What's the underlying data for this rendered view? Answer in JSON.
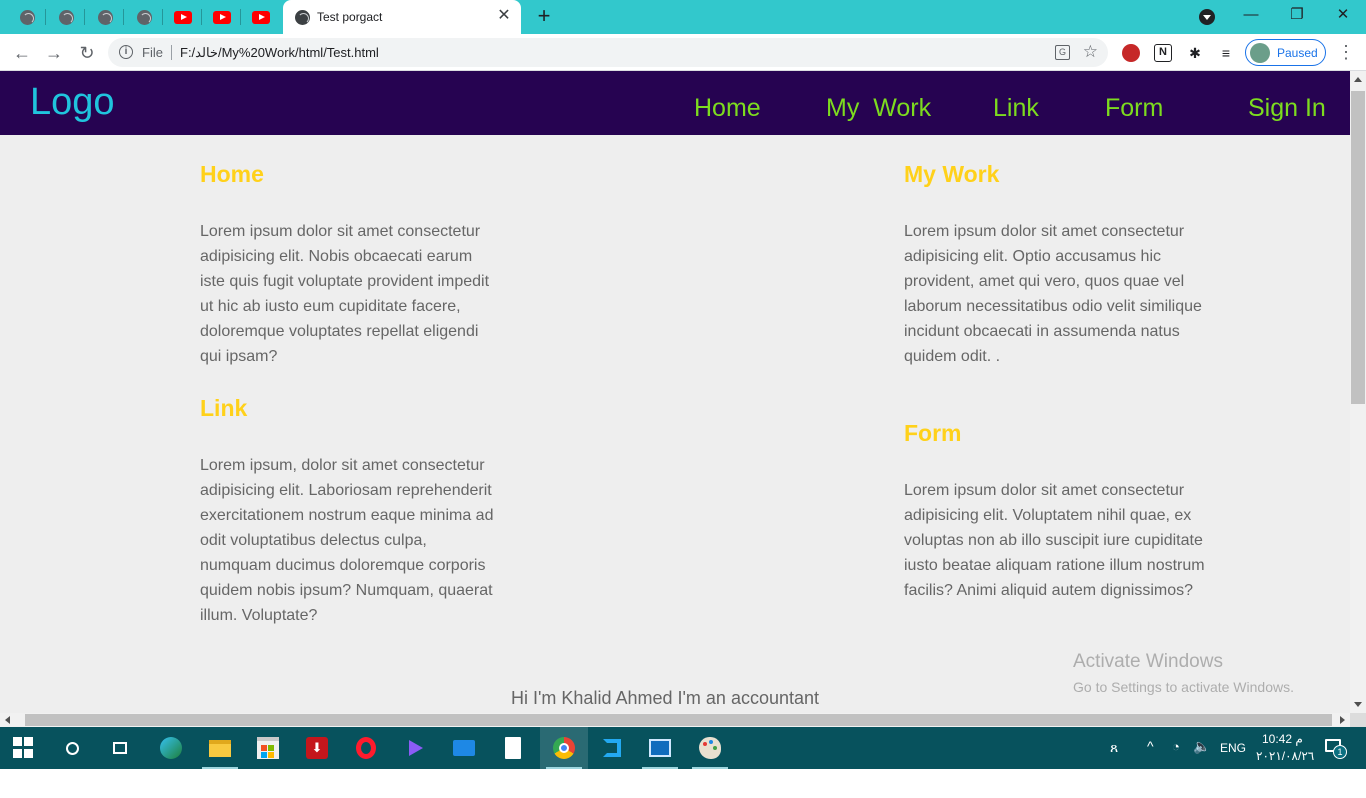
{
  "browser": {
    "active_tab_title": "Test porgact",
    "url_scheme": "File",
    "url": "F:/خالد/My%20Work/html/Test.html",
    "profile_status": "Paused",
    "tab_close": "✕",
    "new_tab": "+",
    "minimize": "—",
    "restore": "❐",
    "close": "✕"
  },
  "site": {
    "logo": "Logo",
    "nav": [
      "Home",
      "My  Work",
      "Link",
      "Form",
      "Sign In"
    ],
    "sections": [
      {
        "title": "Home",
        "body": "Lorem ipsum dolor sit amet consectetur adipisicing elit. Nobis obcaecati earum iste quis fugit voluptate provident impedit ut hic ab iusto eum cupiditate facere, doloremque voluptates repellat eligendi qui ipsam?"
      },
      {
        "title": "My Work",
        "body": "Lorem ipsum dolor sit amet consectetur adipisicing elit. Optio accusamus hic provident, amet qui vero, quos quae vel laborum necessitatibus odio velit similique incidunt obcaecati in assumenda natus quidem odit. ."
      },
      {
        "title": "Link",
        "body": "Lorem ipsum, dolor sit amet consectetur adipisicing elit. Laboriosam reprehenderit exercitationem nostrum eaque minima ad odit voluptatibus delectus culpa, numquam ducimus doloremque corporis quidem nobis ipsum? Numquam, quaerat illum. Voluptate?"
      },
      {
        "title": "Form",
        "body": "Lorem ipsum dolor sit amet consectetur adipisicing elit. Voluptatem nihil quae, ex voluptas non ab illo suscipit iure cupiditate iusto beatae aliquam ratione illum nostrum facilis? Animi aliquid autem dignissimos?"
      }
    ],
    "footer": "Hi I'm Khalid Ahmed I'm an accountant"
  },
  "watermark": {
    "line1": "Activate Windows",
    "line2": "Go to Settings to activate Windows."
  },
  "taskbar": {
    "lang": "ENG",
    "time": "10:42 م",
    "date": "٢٠٢١/٠٨/٢٦",
    "notification_count": "1"
  },
  "colors": {
    "tab_strip": "#32c8cc",
    "site_header": "#260351",
    "logo": "#20c4dd",
    "nav": "#7ddc1f",
    "section_title": "#ffd11a",
    "taskbar": "#07525d"
  }
}
